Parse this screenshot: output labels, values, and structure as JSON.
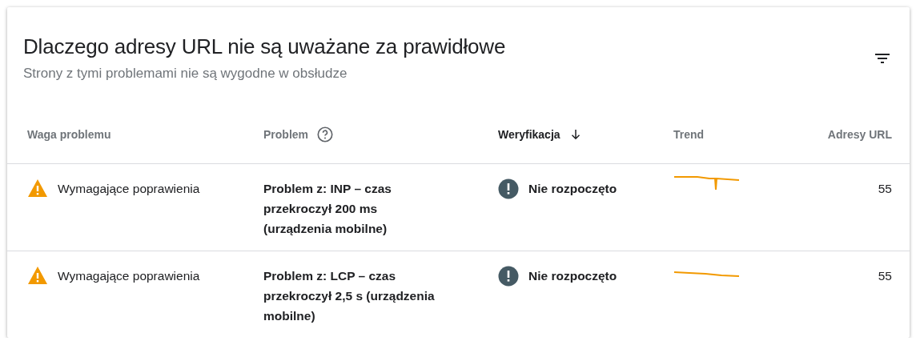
{
  "card": {
    "title": "Dlaczego adresy URL nie są uważane za prawidłowe",
    "subtitle": "Strony z tymi problemami nie są wygodne w obsłudze"
  },
  "table": {
    "columns": [
      {
        "label": "Waga problemu",
        "help": false,
        "sorted": false
      },
      {
        "label": "Problem",
        "help": true,
        "sorted": false
      },
      {
        "label": "Weryfikacja",
        "help": false,
        "sorted": true
      },
      {
        "label": "Trend",
        "help": false,
        "sorted": false
      },
      {
        "label": "Adresy URL",
        "help": false,
        "sorted": false
      }
    ],
    "rows": [
      {
        "severity": "Wymagające poprawienia",
        "problem": "Problem z: INP – czas przekroczył 200 ms (urządzenia mobilne)",
        "verification": "Nie rozpoczęto",
        "trend": {
          "kind": "dip"
        },
        "urls": "55"
      },
      {
        "severity": "Wymagające poprawienia",
        "problem": "Problem z: LCP – czas przekroczył 2,5 s (urządzenia mobilne)",
        "verification": "Nie rozpoczęto",
        "trend": {
          "kind": "flat"
        },
        "urls": "55"
      }
    ]
  }
}
